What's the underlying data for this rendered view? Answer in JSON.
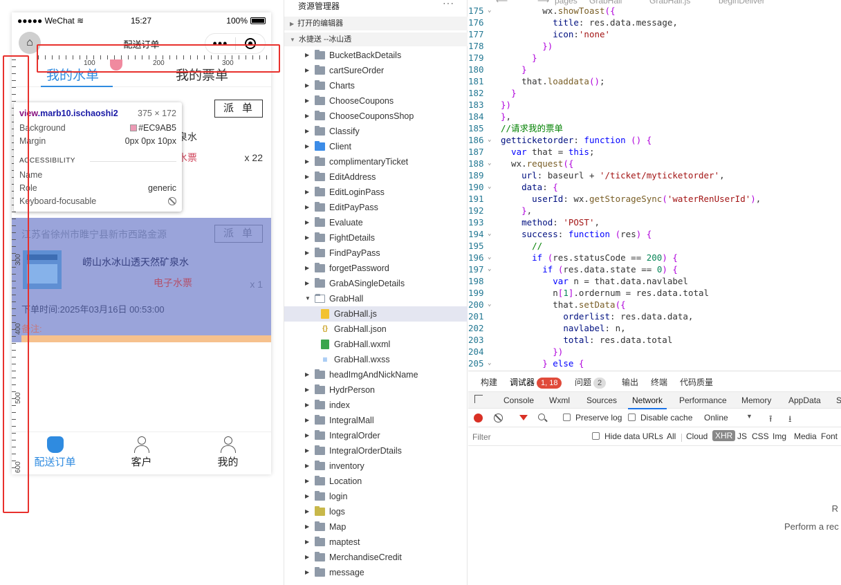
{
  "simulator": {
    "status_left": "●●●●● WeChat",
    "status_wifi": "≋",
    "time": "15:27",
    "battery": "100%",
    "nav_title": "配送订单",
    "capsule_more": "•••",
    "tabs": [
      "我的水单",
      "我的票单"
    ],
    "card1": {
      "addr_partial": "",
      "dispatch": "派单",
      "prod_name_partial": "泉水",
      "ticket_partial": "水票",
      "qty": "x 22"
    },
    "card2": {
      "addr": "江苏省徐州市睢宁县新市西路金源",
      "dispatch": "派单",
      "prod_name": "崂山水冰山透天然矿泉水",
      "ticket_type": "电子水票",
      "qty": "x 1",
      "order_time": "下单时间:2025年03月16日 00:53:00",
      "note": "备注:"
    },
    "tabbar": [
      {
        "label": "配送订单",
        "icon": "hand-tap-icon",
        "active": true
      },
      {
        "label": "客户",
        "icon": "add-person-icon",
        "active": false
      },
      {
        "label": "我的",
        "icon": "person-icon",
        "active": false
      }
    ],
    "ruler_h_labels": [
      "100",
      "200",
      "300"
    ],
    "ruler_v_labels": [
      "300",
      "400",
      "500",
      "600"
    ],
    "inspector": {
      "tag": "view",
      "cls": ".marb10.ischaoshi2",
      "size": "375 × 172",
      "bg_label": "Background",
      "bg_value": "#EC9AB5",
      "margin_label": "Margin",
      "margin_value": "0px 0px 10px",
      "section": "ACCESSIBILITY",
      "name_label": "Name",
      "role_label": "Role",
      "role_value": "generic",
      "focus_label": "Keyboard-focusable"
    }
  },
  "explorer": {
    "title": "资源管理器",
    "more": "···",
    "section_open": "打开的编辑器",
    "section_project": "水捷送 --冰山透",
    "items": [
      {
        "label": "BucketBackDetails",
        "type": "folder"
      },
      {
        "label": "cartSureOrder",
        "type": "folder"
      },
      {
        "label": "Charts",
        "type": "folder"
      },
      {
        "label": "ChooseCoupons",
        "type": "folder"
      },
      {
        "label": "ChooseCouponsShop",
        "type": "folder"
      },
      {
        "label": "Classify",
        "type": "folder"
      },
      {
        "label": "Client",
        "type": "folder-blue"
      },
      {
        "label": "complimentaryTicket",
        "type": "folder"
      },
      {
        "label": "EditAddress",
        "type": "folder"
      },
      {
        "label": "EditLoginPass",
        "type": "folder"
      },
      {
        "label": "EditPayPass",
        "type": "folder"
      },
      {
        "label": "Evaluate",
        "type": "folder"
      },
      {
        "label": "FightDetails",
        "type": "folder"
      },
      {
        "label": "FindPayPass",
        "type": "folder"
      },
      {
        "label": "forgetPassword",
        "type": "folder"
      },
      {
        "label": "GrabASingleDetails",
        "type": "folder"
      },
      {
        "label": "GrabHall",
        "type": "folder-open"
      },
      {
        "label": "GrabHall.js",
        "type": "js"
      },
      {
        "label": "GrabHall.json",
        "type": "json"
      },
      {
        "label": "GrabHall.wxml",
        "type": "wxml"
      },
      {
        "label": "GrabHall.wxss",
        "type": "wxss"
      },
      {
        "label": "headImgAndNickName",
        "type": "folder"
      },
      {
        "label": "HydrPerson",
        "type": "folder"
      },
      {
        "label": "index",
        "type": "folder"
      },
      {
        "label": "IntegralMall",
        "type": "folder"
      },
      {
        "label": "IntegralOrder",
        "type": "folder"
      },
      {
        "label": "IntegralOrderDtails",
        "type": "folder"
      },
      {
        "label": "inventory",
        "type": "folder"
      },
      {
        "label": "Location",
        "type": "folder"
      },
      {
        "label": "login",
        "type": "folder"
      },
      {
        "label": "logs",
        "type": "folder-yellow"
      },
      {
        "label": "Map",
        "type": "folder"
      },
      {
        "label": "maptest",
        "type": "folder"
      },
      {
        "label": "MerchandiseCredit",
        "type": "folder"
      },
      {
        "label": "message",
        "type": "folder"
      }
    ]
  },
  "editor": {
    "breadcrumb": [
      "pages",
      "GrabHall",
      "GrabHall.js",
      "beginDeliver"
    ],
    "lines": [
      {
        "n": "175",
        "fold": "⌄",
        "code": "        wx.showToast({"
      },
      {
        "n": "176",
        "fold": "",
        "code": "          title: res.data.message,"
      },
      {
        "n": "177",
        "fold": "",
        "code": "          icon:'none'"
      },
      {
        "n": "178",
        "fold": "",
        "code": "        })"
      },
      {
        "n": "179",
        "fold": "",
        "code": "      }"
      },
      {
        "n": "180",
        "fold": "",
        "code": "    }"
      },
      {
        "n": "181",
        "fold": "",
        "code": "    that.loaddata();"
      },
      {
        "n": "182",
        "fold": "",
        "code": "  }"
      },
      {
        "n": "183",
        "fold": "",
        "code": "})"
      },
      {
        "n": "184",
        "fold": "",
        "code": "},"
      },
      {
        "n": "185",
        "fold": "",
        "code": "//请求我的票单"
      },
      {
        "n": "186",
        "fold": "⌄",
        "code": "getticketorder: function () {"
      },
      {
        "n": "187",
        "fold": "",
        "code": "  var that = this;"
      },
      {
        "n": "188",
        "fold": "⌄",
        "code": "  wx.request({"
      },
      {
        "n": "189",
        "fold": "",
        "code": "    url: baseurl + '/ticket/myticketorder',"
      },
      {
        "n": "190",
        "fold": "⌄",
        "code": "    data: {"
      },
      {
        "n": "191",
        "fold": "",
        "code": "      userId: wx.getStorageSync('waterRenUserId'),"
      },
      {
        "n": "192",
        "fold": "",
        "code": "    },"
      },
      {
        "n": "193",
        "fold": "",
        "code": "    method: 'POST',"
      },
      {
        "n": "194",
        "fold": "⌄",
        "code": "    success: function (res) {"
      },
      {
        "n": "195",
        "fold": "",
        "code": "      //"
      },
      {
        "n": "196",
        "fold": "⌄",
        "code": "      if (res.statusCode == 200) {"
      },
      {
        "n": "197",
        "fold": "⌄",
        "code": "        if (res.data.state == 0) {"
      },
      {
        "n": "198",
        "fold": "",
        "code": "          var n = that.data.navlabel"
      },
      {
        "n": "199",
        "fold": "",
        "code": "          n[1].ordernum = res.data.total"
      },
      {
        "n": "200",
        "fold": "⌄",
        "code": "          that.setData({"
      },
      {
        "n": "201",
        "fold": "",
        "code": "            orderlist: res.data.data,"
      },
      {
        "n": "202",
        "fold": "",
        "code": "            navlabel: n,"
      },
      {
        "n": "203",
        "fold": "",
        "code": "            total: res.data.total"
      },
      {
        "n": "204",
        "fold": "",
        "code": "          })"
      },
      {
        "n": "205",
        "fold": "⌄",
        "code": "        } else {"
      }
    ]
  },
  "devtools": {
    "top_tabs": [
      "构建",
      "调试器",
      "问题",
      "输出",
      "终端",
      "代码质量"
    ],
    "debugger_badge": "1, 18",
    "problems_badge": "2",
    "panel_tabs": [
      "Console",
      "Wxml",
      "Sources",
      "Network",
      "Performance",
      "Memory",
      "AppData",
      "S"
    ],
    "preserve_log": "Preserve log",
    "disable_cache": "Disable cache",
    "throttle": "Online",
    "filter_placeholder": "Filter",
    "hide_data_urls": "Hide data URLs",
    "types": [
      "All",
      "Cloud",
      "XHR",
      "JS",
      "CSS",
      "Img",
      "Media",
      "Font"
    ],
    "empty_r": "R",
    "empty_perform": "Perform a rec"
  }
}
